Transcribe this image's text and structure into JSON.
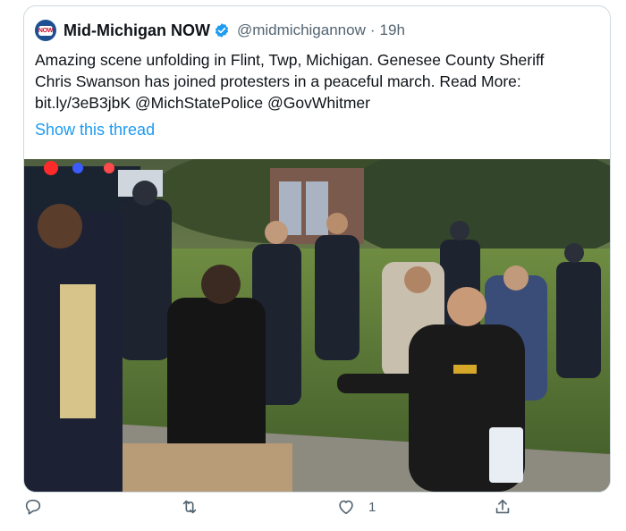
{
  "tweet": {
    "author_name": "Mid-Michigan NOW",
    "author_handle": "@midmichigannow",
    "separator": "·",
    "time": "19h",
    "text_lines": [
      "Amazing scene unfolding in Flint, Twp, Michigan. Genesee County Sheriff",
      "Chris Swanson has joined protesters in a peaceful march.   Read More:",
      "bit.ly/3eB3jbK    @MichStatePolice @GovWhitmer"
    ],
    "show_thread": "Show this thread",
    "avatar_text": "NOW"
  },
  "actions": {
    "reply_icon": "reply-icon",
    "retweet_icon": "retweet-icon",
    "like_icon": "heart-icon",
    "like_count": "1",
    "share_icon": "share-icon"
  },
  "colors": {
    "verified": "#1d9bf0",
    "link": "#1d9bf0",
    "muted": "#536471",
    "border": "#cfd9de"
  }
}
